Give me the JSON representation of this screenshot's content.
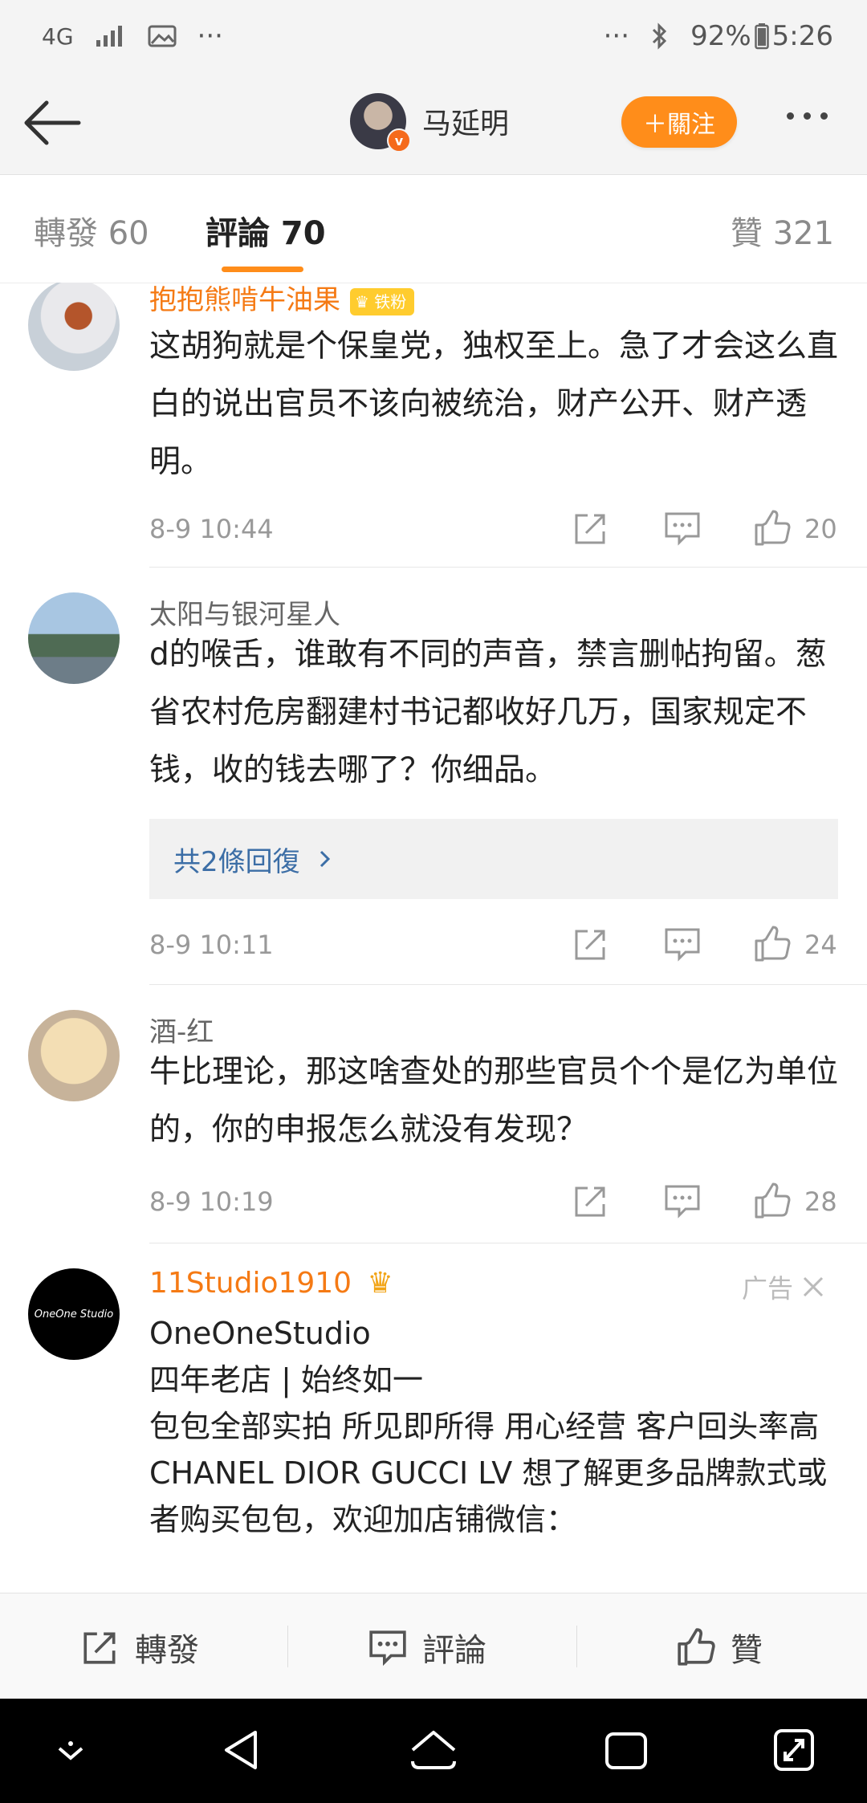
{
  "status_bar": {
    "network": "4G",
    "more_left": "···",
    "more_right": "···",
    "battery": "92%",
    "time": "5:26"
  },
  "header": {
    "back_icon": "back-arrow-icon",
    "user_name": "马延明",
    "follow_label": "＋關注",
    "more_icon": "more-dots-icon",
    "verified_badge": "v"
  },
  "tabs": [
    {
      "label": "轉發 60"
    },
    {
      "label": "評論 70"
    },
    {
      "label": "贊 321"
    }
  ],
  "comments": [
    {
      "name": "抱抱熊啃牛油果",
      "badge": "铁粉",
      "text": "这胡狗就是个保皇党，独权至上。急了才会这么直白的说出官员不该向被统治，财产公开、财产透明。",
      "time": "8-9 10:44",
      "likes": "20"
    },
    {
      "name": "太阳与银河星人",
      "text": "d的喉舌，谁敢有不同的声音，禁言删帖拘留。葱省农村危房翻建村书记都收好几万，国家规定不钱，收的钱去哪了？你细品。",
      "replies": "共2條回復",
      "time": "8-9 10:11",
      "likes": "24"
    },
    {
      "name": "酒-红",
      "text": "牛比理论，那这啥查处的那些官员个个是亿为单位的，你的申报怎么就没有发现？",
      "time": "8-9 10:19",
      "likes": "28"
    }
  ],
  "ad": {
    "name": "11Studio1910",
    "avatar_text": "OneOne Studio",
    "label": "广告",
    "lines": [
      "OneOneStudio",
      "四年老店 | 始终如一",
      "包包全部实拍 所见即所得 用心经营 客户回头率高",
      "CHANEL DIOR GUCCI LV 想了解更多品牌款式或者购买包包，欢迎加店铺微信："
    ]
  },
  "bottom_bar": {
    "repost": "轉發",
    "comment": "評論",
    "like": "贊"
  },
  "colors": {
    "accent": "#ff8d1a",
    "vip_name": "#f57a14",
    "link": "#3c6ea6"
  }
}
